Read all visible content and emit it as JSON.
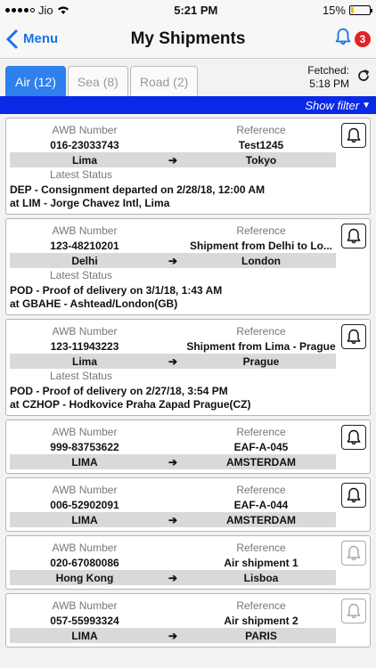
{
  "status_bar": {
    "carrier": "Jio",
    "time": "5:21 PM",
    "battery": "15%",
    "battery_level": 0.15
  },
  "nav": {
    "back_label": "Menu",
    "title": "My Shipments",
    "badge_count": "3"
  },
  "tabs": [
    {
      "label": "Air (12)",
      "active": true
    },
    {
      "label": "Sea (8)",
      "active": false
    },
    {
      "label": "Road (2)",
      "active": false
    }
  ],
  "fetched": {
    "label": "Fetched:",
    "time": "5:18 PM"
  },
  "filter": {
    "label": "Show filter"
  },
  "labels": {
    "awb": "AWB Number",
    "reference": "Reference",
    "latest_status": "Latest Status"
  },
  "shipments": [
    {
      "awb": "016-23033743",
      "reference": "Test1245",
      "origin": "Lima",
      "destination": "Tokyo",
      "status_line1": "DEP - Consignment departed on 2/28/18, 12:00 AM",
      "status_line2": "at LIM - Jorge Chavez Intl, Lima",
      "bell_active": true
    },
    {
      "awb": "123-48210201",
      "reference": "Shipment from Delhi to Lo...",
      "origin": "Delhi",
      "destination": "London",
      "status_line1": "POD - Proof of delivery on 3/1/18, 1:43 AM",
      "status_line2": "at GBAHE - Ashtead/London(GB)",
      "bell_active": true
    },
    {
      "awb": "123-11943223",
      "reference": "Shipment from Lima - Prague",
      "origin": "Lima",
      "destination": "Prague",
      "status_line1": "POD - Proof of delivery on 2/27/18, 3:54 PM",
      "status_line2": "at CZHOP - Hodkovice Praha Zapad Prague(CZ)",
      "bell_active": true
    },
    {
      "awb": "999-83753622",
      "reference": "EAF-A-045",
      "origin": "LIMA",
      "destination": "AMSTERDAM",
      "bell_active": true
    },
    {
      "awb": "006-52902091",
      "reference": "EAF-A-044",
      "origin": "LIMA",
      "destination": "AMSTERDAM",
      "bell_active": true
    },
    {
      "awb": "020-67080086",
      "reference": "Air shipment 1",
      "origin": "Hong Kong",
      "destination": "Lisboa",
      "bell_active": false
    },
    {
      "awb": "057-55993324",
      "reference": "Air shipment 2",
      "origin": "LIMA",
      "destination": "PARIS",
      "bell_active": false
    }
  ],
  "colors": {
    "accent": "#2f80ed",
    "filter_bar": "#0a29e6",
    "badge": "#e02424"
  }
}
